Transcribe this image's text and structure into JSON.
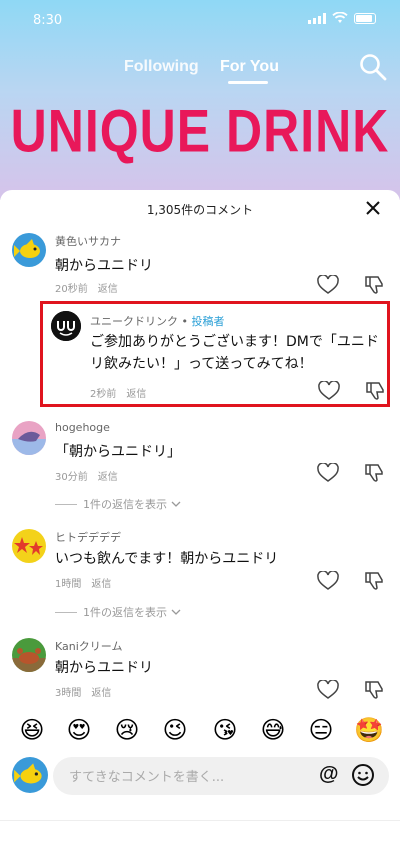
{
  "status_bar": {
    "time": "8:30"
  },
  "top_nav": {
    "tabs": [
      "Following",
      "For You"
    ],
    "active_tab": "For You"
  },
  "brand": {
    "title": "UNIQUE DRINK",
    "color": "#e8185a"
  },
  "comments_sheet": {
    "header": "1,305件のコメント",
    "comments": [
      {
        "user": "黄色いサカナ",
        "text": "朝からユニドリ",
        "time": "20秒前",
        "reply_label": "返信"
      },
      {
        "user": "hogehoge",
        "text": "「朝からユニドリ」",
        "time": "30分前",
        "reply_label": "返信",
        "replies_toggle": "1件の返信を表示"
      },
      {
        "user": "ヒトデデデデ",
        "text": "いつも飲んでます！朝からユニドリ",
        "time": "1時間",
        "reply_label": "返信",
        "replies_toggle": "1件の返信を表示"
      },
      {
        "user": "Kaniクリーム",
        "text": "朝からユニドリ",
        "time": "3時間",
        "reply_label": "返信"
      }
    ],
    "author_reply": {
      "user": "ユニークドリンク",
      "separator": " • ",
      "author_tag": "投稿者",
      "text": "ご参加ありがとうございます！DMで「ユニドリ飲みたい！」って送ってみてね！",
      "time": "2秒前",
      "reply_label": "返信",
      "highlight_color": "#e0141e"
    }
  },
  "emoji_bar": [
    "😆",
    "😍",
    "😢",
    "😉",
    "😘",
    "😅",
    "😑",
    "🤩"
  ],
  "composer": {
    "placeholder": "すてきなコメントを書く...",
    "mention_symbol": "@"
  }
}
